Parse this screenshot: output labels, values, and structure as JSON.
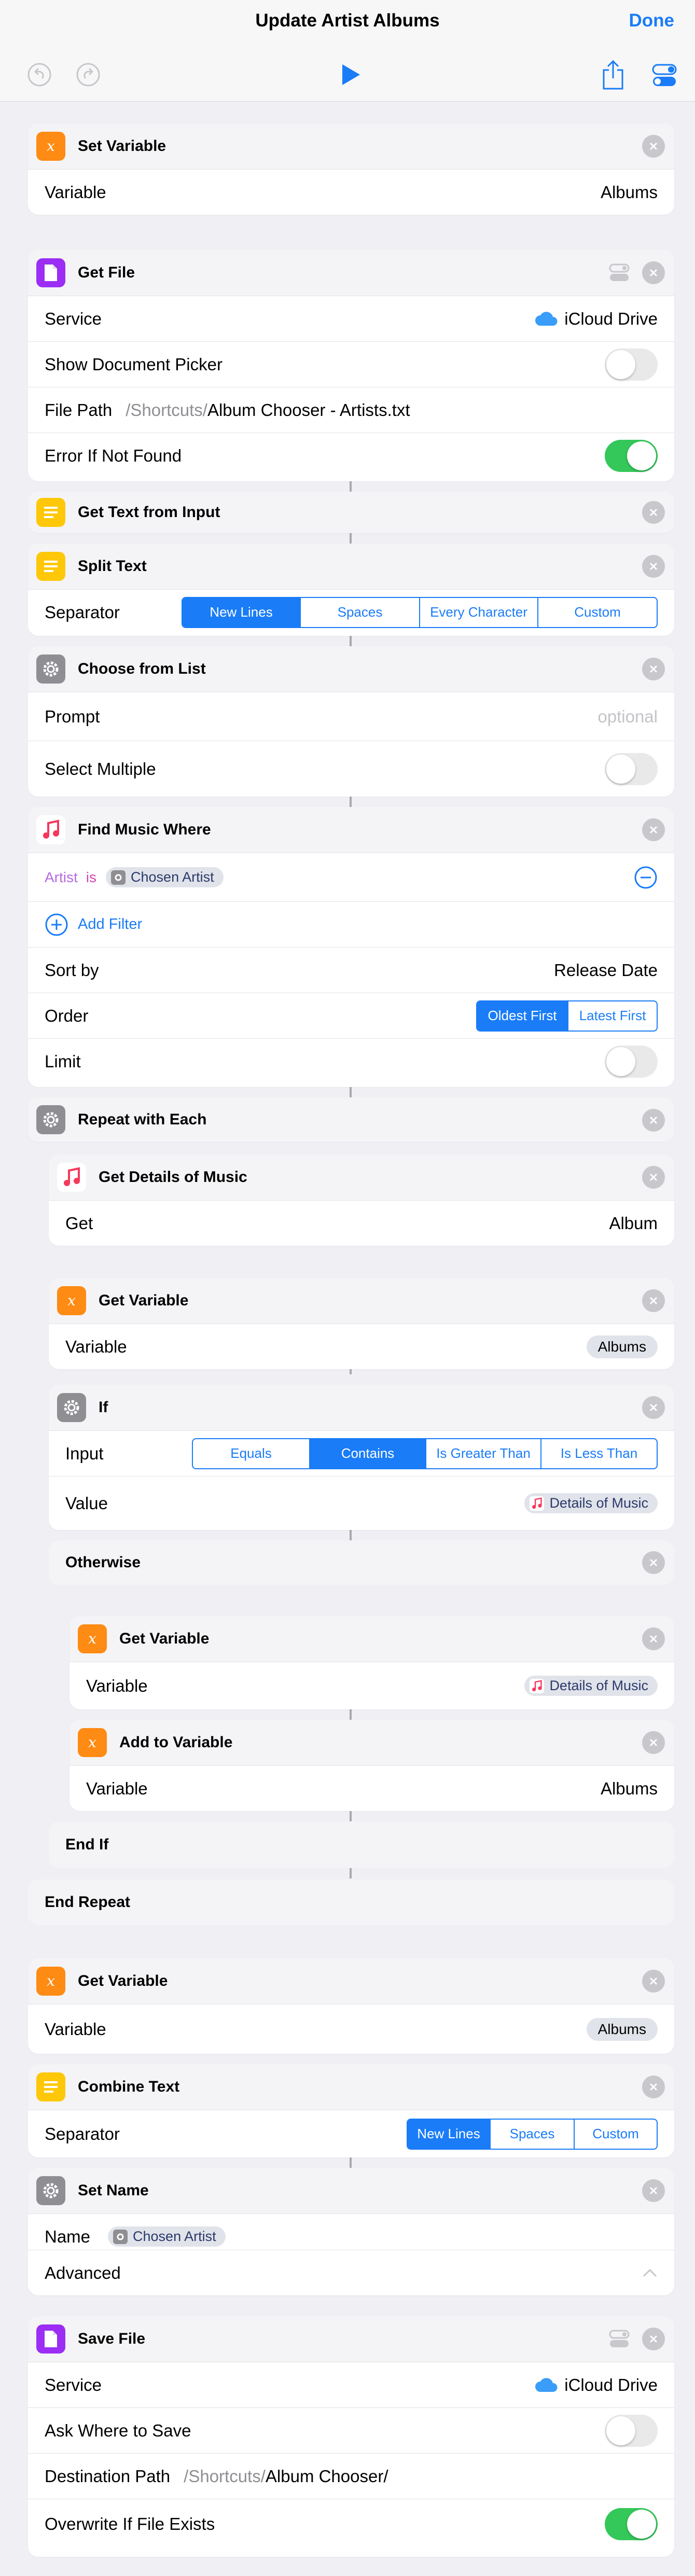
{
  "header": {
    "title": "Update Artist Albums",
    "done": "Done"
  },
  "actions": {
    "set_variable": {
      "title": "Set Variable",
      "label": "Variable",
      "value": "Albums"
    },
    "get_file": {
      "title": "Get File",
      "service_label": "Service",
      "service_value": "iCloud Drive",
      "picker_label": "Show Document Picker",
      "picker_on": false,
      "path_label": "File Path",
      "path_prefix": "/Shortcuts/",
      "path_value": "Album Chooser - Artists.txt",
      "error_label": "Error If Not Found",
      "error_on": true
    },
    "get_text": {
      "title": "Get Text from Input"
    },
    "split_text": {
      "title": "Split Text",
      "label": "Separator",
      "options": [
        "New Lines",
        "Spaces",
        "Every Character",
        "Custom"
      ],
      "selected": 0
    },
    "choose": {
      "title": "Choose from List",
      "prompt_label": "Prompt",
      "prompt_placeholder": "optional",
      "multi_label": "Select Multiple",
      "multi_on": false
    },
    "find_music": {
      "title": "Find Music Where",
      "filter_field": "Artist",
      "filter_op": "is",
      "filter_value": "Chosen Artist",
      "add_filter": "Add Filter",
      "sort_label": "Sort by",
      "sort_value": "Release Date",
      "order_label": "Order",
      "order_options": [
        "Oldest First",
        "Latest First"
      ],
      "order_selected": 0,
      "limit_label": "Limit",
      "limit_on": false
    },
    "repeat": {
      "title": "Repeat with Each"
    },
    "get_details": {
      "title": "Get Details of Music",
      "label": "Get",
      "value": "Album"
    },
    "get_var1": {
      "title": "Get Variable",
      "label": "Variable",
      "value": "Albums"
    },
    "if": {
      "title": "If",
      "input_label": "Input",
      "options": [
        "Equals",
        "Contains",
        "Is Greater Than",
        "Is Less Than"
      ],
      "selected": 1,
      "value_label": "Value",
      "value": "Details of Music"
    },
    "otherwise": {
      "title": "Otherwise"
    },
    "get_var2": {
      "title": "Get Variable",
      "label": "Variable",
      "value": "Details of Music"
    },
    "add_var": {
      "title": "Add to Variable",
      "label": "Variable",
      "value": "Albums"
    },
    "end_if": {
      "title": "End If"
    },
    "end_repeat": {
      "title": "End Repeat"
    },
    "get_var3": {
      "title": "Get Variable",
      "label": "Variable",
      "value": "Albums"
    },
    "combine": {
      "title": "Combine Text",
      "label": "Separator",
      "options": [
        "New Lines",
        "Spaces",
        "Custom"
      ],
      "selected": 0
    },
    "set_name": {
      "title": "Set Name",
      "name_label": "Name",
      "name_value": "Chosen Artist",
      "advanced_label": "Advanced"
    },
    "save_file": {
      "title": "Save File",
      "service_label": "Service",
      "service_value": "iCloud Drive",
      "ask_label": "Ask Where to Save",
      "ask_on": false,
      "dest_label": "Destination Path",
      "dest_prefix": "/Shortcuts/",
      "dest_value": "Album Chooser/",
      "overwrite_label": "Overwrite If File Exists",
      "overwrite_on": true
    }
  },
  "colors": {
    "accent": "#1a7cf7",
    "variable": "#fe8b14",
    "documents": "#9b2df5",
    "text": "#fec809",
    "scripting": "#8e8e93",
    "switch_on": "#34c759"
  }
}
